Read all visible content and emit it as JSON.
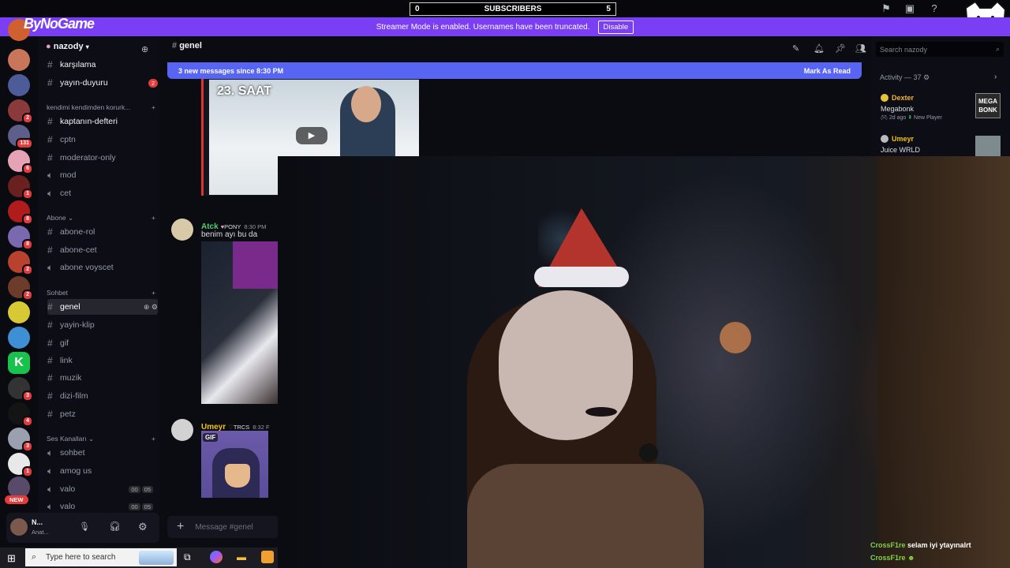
{
  "brand": "ByNoGame",
  "subscribers": {
    "left": "0",
    "label": "SUBSCRIBERS",
    "right": "5"
  },
  "streamer_banner": {
    "text": "Streamer Mode is enabled. Usernames have been truncated.",
    "button": "Disable"
  },
  "guild": {
    "name": "nazody"
  },
  "channels_top": [
    {
      "name": "karşılama",
      "unread": true
    },
    {
      "name": "yayın-duyuru",
      "unread": true,
      "count": "2"
    }
  ],
  "categories": {
    "c1": "kendimi kendimden korurk...",
    "c2": "Abone",
    "c3": "Sohbet",
    "c4": "Ses Kanalları"
  },
  "channels_c1": [
    {
      "name": "kaptanın-defteri",
      "unread": true
    },
    {
      "name": "cptn"
    },
    {
      "name": "moderator-only"
    },
    {
      "name": "mod",
      "voice": true
    },
    {
      "name": "cet",
      "voice": true
    }
  ],
  "channels_c2": [
    {
      "name": "abone-rol"
    },
    {
      "name": "abone-cet"
    },
    {
      "name": "abone voyscet",
      "voice": true
    }
  ],
  "channels_c3": [
    {
      "name": "genel",
      "active": true
    },
    {
      "name": "yayin-klip"
    },
    {
      "name": "gif"
    },
    {
      "name": "link"
    },
    {
      "name": "muzik"
    },
    {
      "name": "dizi-film"
    },
    {
      "name": "petz"
    }
  ],
  "channels_c4": [
    {
      "name": "sohbet"
    },
    {
      "name": "amog us"
    },
    {
      "name": "valo",
      "tag1": "00",
      "tag2": "05"
    },
    {
      "name": "valo",
      "tag1": "00",
      "tag2": "05"
    }
  ],
  "server_badges": [
    "2",
    "131",
    "6",
    "1",
    "8",
    "8",
    "2",
    "2",
    "3",
    "2",
    "4",
    "3",
    "1"
  ],
  "new_pill": "NEW",
  "user": {
    "name": "N...",
    "status": "Anat..."
  },
  "channel_header": "genel",
  "new_messages": {
    "text": "3 new messages since 8:30 PM",
    "action": "Mark As Read"
  },
  "video_thumb_text": "23. SAAT",
  "messages": [
    {
      "author": "Atck",
      "author_color": "#4fd16b",
      "tag": "PONY",
      "time": "8:30 PM",
      "text": "benim ayı bu da"
    },
    {
      "author": "Umeyr",
      "author_color": "#f1c40f",
      "tag": "TRCS",
      "time": "8:32 F",
      "gif_label": "GIF"
    }
  ],
  "input_placeholder": "Message #genel",
  "search": {
    "placeholder": "Search nazody"
  },
  "activity": {
    "title": "Activity — 37",
    "items": [
      {
        "name": "Dexter",
        "game": "Megabonk",
        "meta1": "2d ago",
        "meta2": "New Player",
        "thumb": "MEGA BONK"
      },
      {
        "name": "Umeyr",
        "game": "Juice WRLD"
      }
    ]
  },
  "chat_overlay": [
    {
      "user": "CrossF1re",
      "text": "selam iyi ytayınalrt"
    },
    {
      "user": "CrossF1re",
      "text": ""
    }
  ],
  "taskbar": {
    "search": "Type here to search"
  }
}
